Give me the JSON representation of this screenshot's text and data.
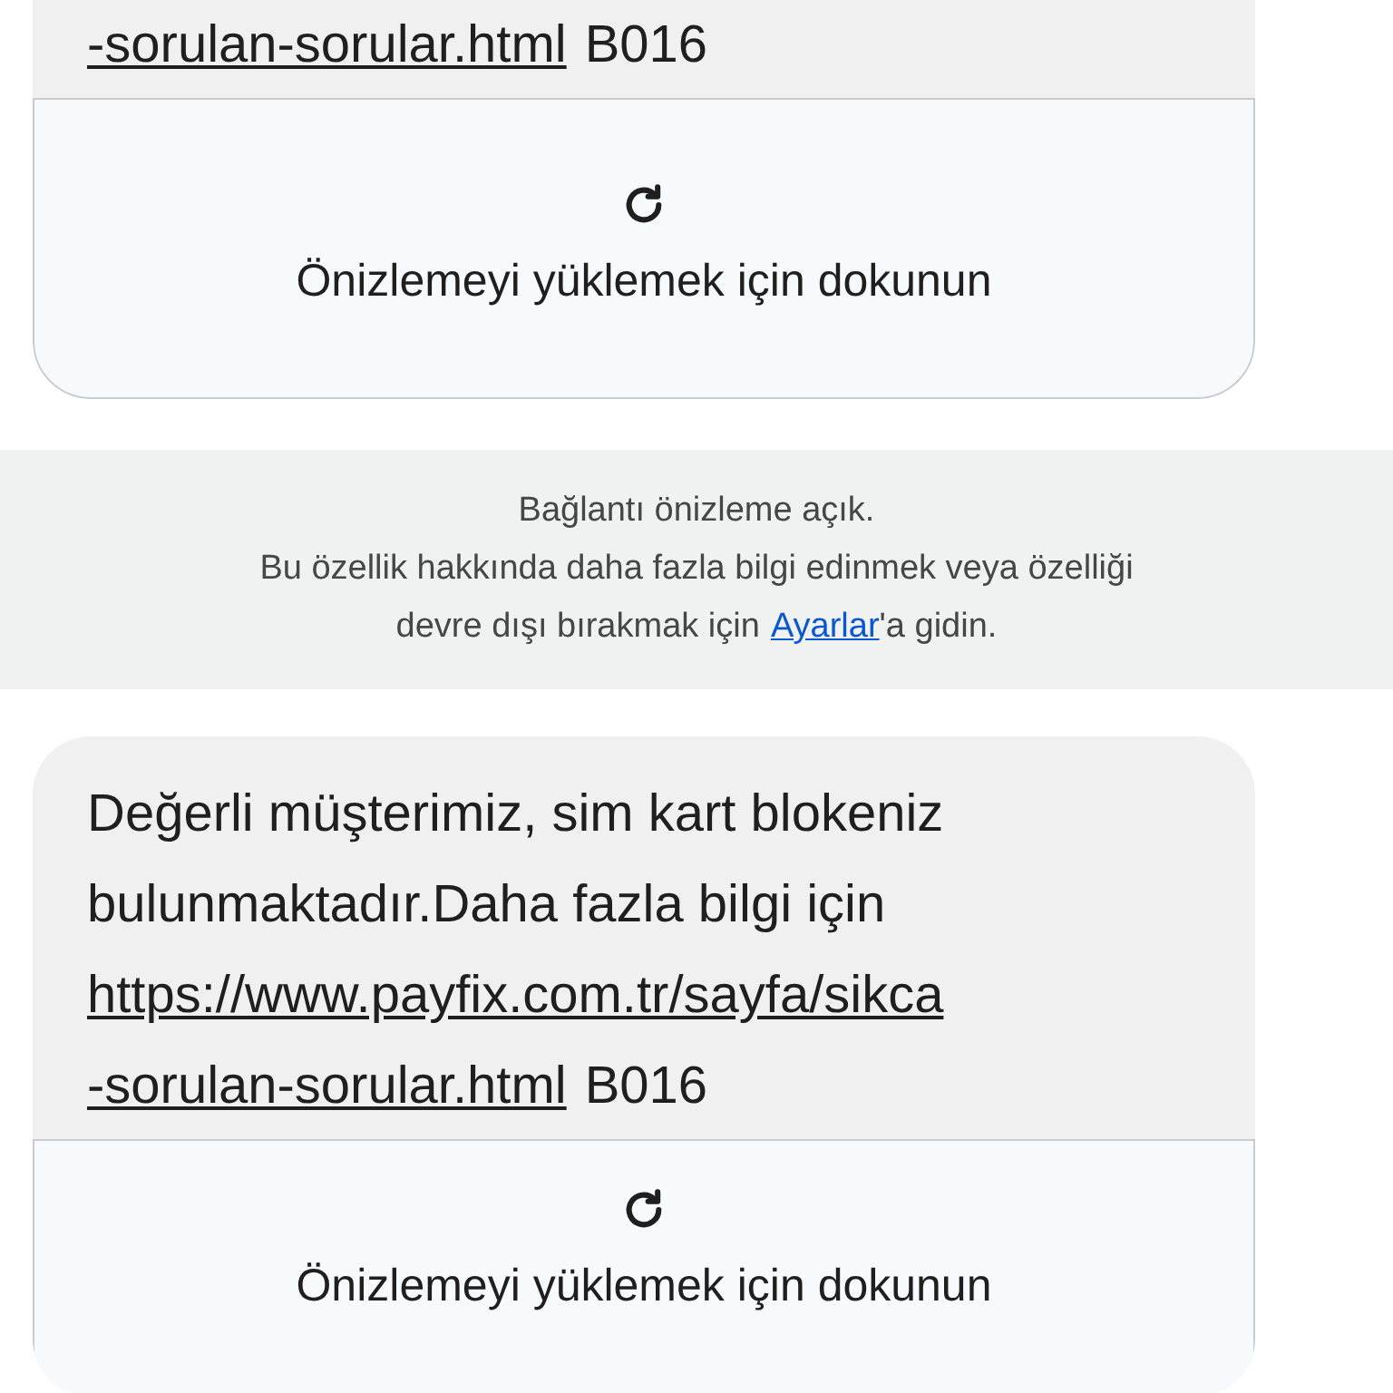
{
  "thread": [
    {
      "kind": "message",
      "link_lines": [
        "-sorulan-sorular.html"
      ],
      "suffix": "B016",
      "preview": {
        "label": "Önizlemeyi yüklemek için dokunun"
      }
    },
    {
      "kind": "notice",
      "title": "Bağlantı önizleme açık.",
      "line": "Bu özellik hakkında daha fazla bilgi edinmek veya özelliği",
      "before_link": "devre dışı bırakmak için",
      "link": "Ayarlar",
      "after_link": "'a gidin."
    },
    {
      "kind": "message",
      "text": "Değerli müşterimiz, sim kart blokeniz bulunmaktadır.Daha fazla bilgi için",
      "link_lines": [
        "https://www.payfix.com.tr/sayfa/sikca",
        "-sorulan-sorular.html"
      ],
      "suffix": "B016",
      "preview": {
        "label": "Önizlemeyi yüklemek için dokunun"
      }
    }
  ]
}
